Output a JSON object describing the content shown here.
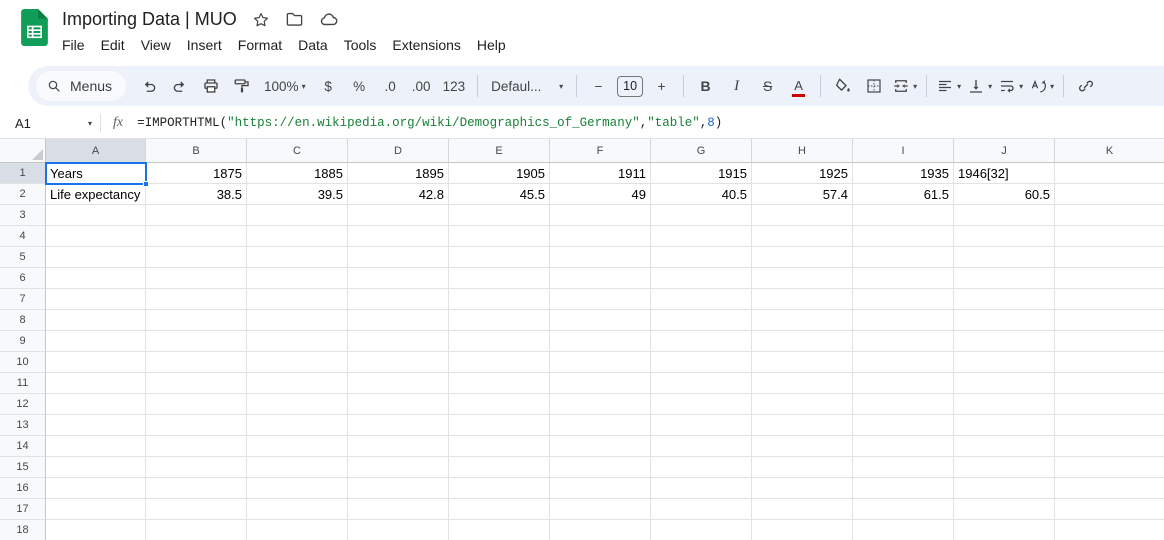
{
  "titlebar": {
    "title": "Importing Data | MUO",
    "menus": [
      "File",
      "Edit",
      "View",
      "Insert",
      "Format",
      "Data",
      "Tools",
      "Extensions",
      "Help"
    ]
  },
  "toolbar": {
    "menus_button": "Menus",
    "zoom": "100%",
    "currency": "$",
    "percent": "%",
    "decrease_decimal": ".0",
    "increase_decimal": ".00",
    "number_format": "123",
    "font_name": "Defaul...",
    "minus": "−",
    "font_size": "10",
    "plus": "+",
    "bold": "B",
    "italic": "I",
    "strikethrough": "S",
    "text_color": "A"
  },
  "formula_bar": {
    "cell_ref": "A1",
    "fx": "fx",
    "parts": [
      {
        "text": "=IMPORTHTML(",
        "color": "#202124"
      },
      {
        "text": "\"https://en.wikipedia.org/wiki/Demographics_of_Germany\"",
        "color": "#188038"
      },
      {
        "text": ",",
        "color": "#202124"
      },
      {
        "text": "\"table\"",
        "color": "#188038"
      },
      {
        "text": ",",
        "color": "#202124"
      },
      {
        "text": "8",
        "color": "#1967d2"
      },
      {
        "text": ")",
        "color": "#202124"
      }
    ]
  },
  "sheet": {
    "columns": [
      "A",
      "B",
      "C",
      "D",
      "E",
      "F",
      "G",
      "H",
      "I",
      "J",
      "K"
    ],
    "row_count": 18,
    "selected_cell": "A1",
    "selected": {
      "col": "A",
      "row": 1
    },
    "rows": [
      [
        "Years",
        "1875",
        "1885",
        "1895",
        "1905",
        "1911",
        "1915",
        "1925",
        "1935",
        "1946[32]",
        ""
      ],
      [
        "Life expectancy",
        "38.5",
        "39.5",
        "42.8",
        "45.5",
        "49",
        "40.5",
        "57.4",
        "61.5",
        "60.5",
        ""
      ]
    ]
  },
  "colors": {
    "selection": "#1a73e8",
    "logo_green": "#0f9d58",
    "toolbar_bg": "#edf2fa",
    "string_token": "#188038",
    "number_token": "#1967d2"
  }
}
